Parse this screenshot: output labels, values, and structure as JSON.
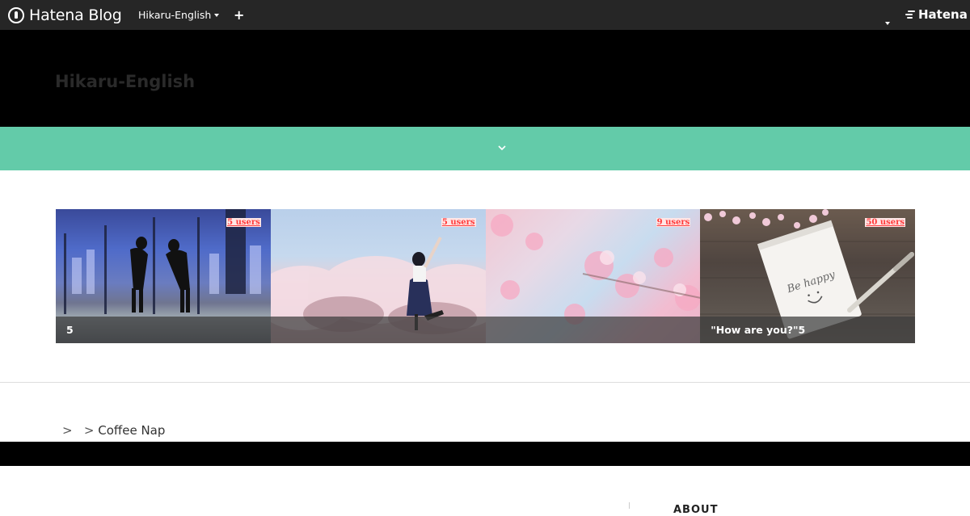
{
  "globalbar": {
    "logo_text": "Hatena Blog",
    "blog_name": "Hikaru-English",
    "add_label": "+",
    "brand_text": "Hatena"
  },
  "header": {
    "blog_title": "Hikaru-English"
  },
  "cards": [
    {
      "title": "5",
      "users": "5 users"
    },
    {
      "title": "",
      "users": "5 users"
    },
    {
      "title": "",
      "users": "9 users"
    },
    {
      "title": "\"How are you?\"5",
      "users": "50 users"
    }
  ],
  "breadcrumb": {
    "items": [
      "",
      "",
      "Coffee Nap"
    ],
    "separator": ">"
  },
  "sidebar": {
    "heading": "ABOUT"
  },
  "colors": {
    "menu_band": "#63cba9",
    "globalbar": "#262626",
    "header_bg": "#000000"
  }
}
